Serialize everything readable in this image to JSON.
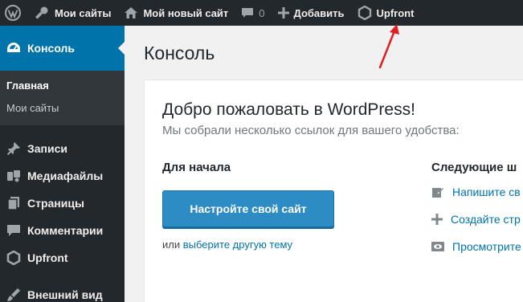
{
  "adminbar": {
    "wp_icon": "wordpress-logo-icon",
    "my_sites": "Мои сайты",
    "site_name": "Мой новый сайт",
    "comments_count": "0",
    "add_new": "Добавить",
    "upfront": "Upfront"
  },
  "sidebar": {
    "current": "Консоль",
    "submenu": [
      "Главная",
      "Мои сайты"
    ],
    "items": [
      {
        "label": "Записи",
        "icon": "pin-icon"
      },
      {
        "label": "Медиафайлы",
        "icon": "media-icon"
      },
      {
        "label": "Страницы",
        "icon": "pages-icon"
      },
      {
        "label": "Комментарии",
        "icon": "comments-icon"
      },
      {
        "label": "Upfront",
        "icon": "upfront-icon"
      },
      {
        "label": "Внешний вид",
        "icon": "appearance-icon"
      }
    ]
  },
  "main": {
    "title": "Консоль",
    "welcome_title": "Добро пожаловать в WordPress!",
    "welcome_subtitle": "Мы собрали несколько ссылок для вашего удобства:",
    "get_started": "Для начала",
    "customize_button": "Настройте свой сайт",
    "alt_prefix": "или",
    "alt_link": "выберите другую тему",
    "next_steps": "Следующие ш",
    "next_items": [
      "Напишите св",
      "Создайте стр",
      "Просмотрите"
    ]
  },
  "colors": {
    "adminbar_bg": "#23282d",
    "accent": "#0073aa",
    "button": "#2e8cc4",
    "annotation_arrow": "#e02020"
  }
}
